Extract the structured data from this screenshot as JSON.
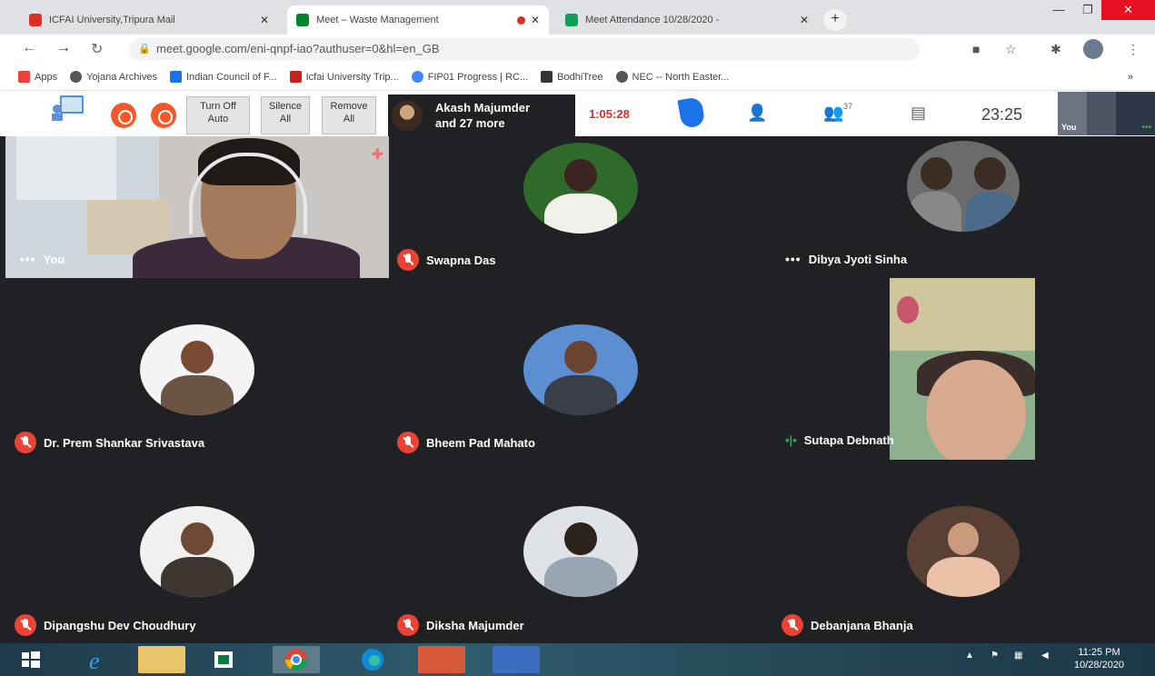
{
  "browser": {
    "tabs": [
      {
        "title": "ICFAI University,Tripura Mail",
        "favicon_color": "#d93025"
      },
      {
        "title": "Meet – Waste Management",
        "favicon_color": "#00832d"
      },
      {
        "title": "Meet Attendance 10/28/2020 -",
        "favicon_color": "#0f9d58"
      }
    ],
    "newtab_label": "+",
    "url": "meet.google.com/eni-qnpf-iao?authuser=0&hl=en_GB",
    "bookmarks": [
      {
        "label": "Apps",
        "color": "#ea4335"
      },
      {
        "label": "Yojana Archives",
        "color": "#555555"
      },
      {
        "label": "Indian Council of F...",
        "color": "#1a73e8"
      },
      {
        "label": "Icfai University Trip...",
        "color": "#c5221f"
      },
      {
        "label": "FIP01 Progress | RC...",
        "color": "#4285f4"
      },
      {
        "label": "BodhiTree",
        "color": "#333333"
      },
      {
        "label": "NEC -- North Easter...",
        "color": "#555555"
      }
    ],
    "bookmarks_more": "»"
  },
  "meet_toolbar": {
    "buttons": [
      {
        "line1": "Turn Off",
        "line2": "Auto"
      },
      {
        "line1": "Silence",
        "line2": "All"
      },
      {
        "line1": "Remove",
        "line2": "All"
      }
    ],
    "speaker": {
      "name": "Akash Majumder",
      "more": "and 27 more"
    },
    "elapsed": "1:05:28",
    "participant_count": "37",
    "time": "23:25",
    "self_label": "You",
    "self_dots": "•••"
  },
  "participants": [
    {
      "name": "You",
      "indicator": "dots"
    },
    {
      "name": "Swapna Das",
      "indicator": "muted"
    },
    {
      "name": "Dibya Jyoti Sinha",
      "indicator": "dots"
    },
    {
      "name": "Dr. Prem Shankar Srivastava",
      "indicator": "muted"
    },
    {
      "name": "Bheem Pad Mahato",
      "indicator": "muted"
    },
    {
      "name": "Sutapa Debnath",
      "indicator": "speaking"
    },
    {
      "name": "Dipangshu Dev Choudhury",
      "indicator": "muted"
    },
    {
      "name": "Diksha Majumder",
      "indicator": "muted"
    },
    {
      "name": "Debanjana Bhanja",
      "indicator": "muted"
    }
  ],
  "indicators": {
    "dots": "•••",
    "speaking": "•|•"
  },
  "taskbar": {
    "clock_time": "11:25 PM",
    "clock_date": "10/28/2020"
  }
}
